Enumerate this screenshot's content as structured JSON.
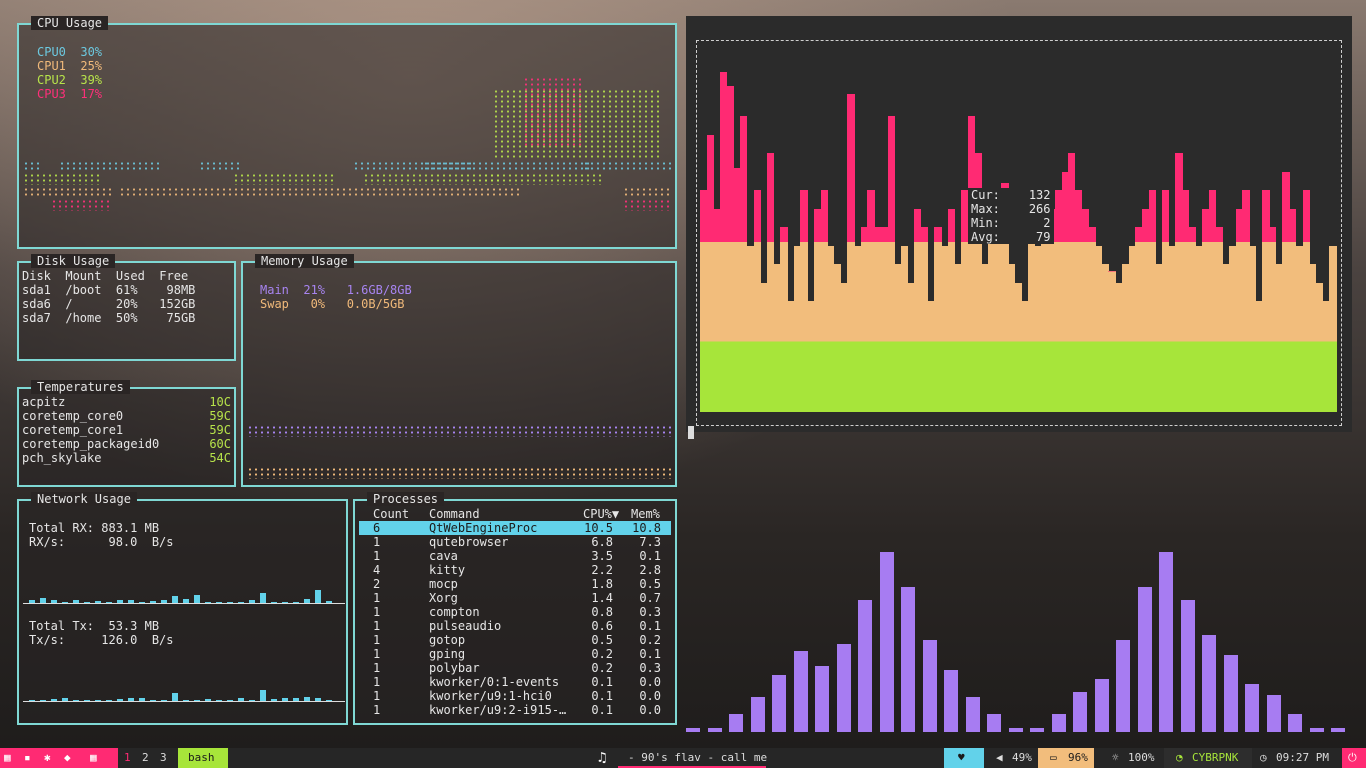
{
  "cpu": {
    "title": "CPU Usage",
    "cores": [
      {
        "name": "CPU0",
        "value": "30%"
      },
      {
        "name": "CPU1",
        "value": "25%"
      },
      {
        "name": "CPU2",
        "value": "39%"
      },
      {
        "name": "CPU3",
        "value": "17%"
      }
    ]
  },
  "disk": {
    "title": "Disk Usage",
    "header": "Disk  Mount  Used  Free",
    "rows": [
      "sda1  /boot  61%    98MB",
      "sda6  /      20%   152GB",
      "sda7  /home  50%    75GB"
    ]
  },
  "memory": {
    "title": "Memory Usage",
    "main": "Main  21%   1.6GB/8GB",
    "swap": "Swap   0%   0.0B/5GB"
  },
  "temps": {
    "title": "Temperatures",
    "rows": [
      {
        "name": "acpitz",
        "value": "10C"
      },
      {
        "name": "coretemp_core0",
        "value": "59C"
      },
      {
        "name": "coretemp_core1",
        "value": "59C"
      },
      {
        "name": "coretemp_packageid0",
        "value": "60C"
      },
      {
        "name": "pch_skylake",
        "value": "54C"
      }
    ]
  },
  "network": {
    "title": "Network Usage",
    "rx_total": "Total RX: 883.1 MB",
    "rx_rate": "RX/s:      98.0  B/s",
    "tx_total": "Total Tx:  53.3 MB",
    "tx_rate": "Tx/s:     126.0  B/s",
    "rx_spark": [
      0.2,
      0.35,
      0.25,
      0.1,
      0.2,
      0,
      0.15,
      0.1,
      0.25,
      0.2,
      0.05,
      0.15,
      0.25,
      0.5,
      0.3,
      0.6,
      0.1,
      0.05,
      0.1,
      0.1,
      0.2,
      0.75,
      0.1,
      0.05,
      0.1,
      0.3,
      0.9,
      0.15
    ],
    "tx_spark": [
      0.05,
      0.1,
      0.15,
      0.25,
      0.1,
      0.05,
      0.1,
      0.05,
      0.15,
      0.2,
      0.2,
      0.05,
      0.1,
      0.6,
      0.1,
      0.05,
      0.15,
      0.1,
      0.1,
      0.2,
      0.05,
      0.8,
      0.15,
      0.2,
      0.25,
      0.3,
      0.2,
      0.05
    ]
  },
  "processes": {
    "title": "Processes",
    "headers": {
      "count": "Count",
      "command": "Command",
      "cpu": "CPU%▼",
      "mem": "Mem%"
    },
    "rows": [
      {
        "count": "6",
        "command": "QtWebEngineProc",
        "cpu": "10.5",
        "mem": "10.8"
      },
      {
        "count": "1",
        "command": "qutebrowser",
        "cpu": "6.8",
        "mem": "7.3"
      },
      {
        "count": "1",
        "command": "cava",
        "cpu": "3.5",
        "mem": "0.1"
      },
      {
        "count": "4",
        "command": "kitty",
        "cpu": "2.2",
        "mem": "2.8"
      },
      {
        "count": "2",
        "command": "mocp",
        "cpu": "1.8",
        "mem": "0.5"
      },
      {
        "count": "1",
        "command": "Xorg",
        "cpu": "1.4",
        "mem": "0.7"
      },
      {
        "count": "1",
        "command": "compton",
        "cpu": "0.8",
        "mem": "0.3"
      },
      {
        "count": "1",
        "command": "pulseaudio",
        "cpu": "0.6",
        "mem": "0.1"
      },
      {
        "count": "1",
        "command": "gotop",
        "cpu": "0.5",
        "mem": "0.2"
      },
      {
        "count": "1",
        "command": "gping",
        "cpu": "0.2",
        "mem": "0.1"
      },
      {
        "count": "1",
        "command": "polybar",
        "cpu": "0.2",
        "mem": "0.3"
      },
      {
        "count": "1",
        "command": "kworker/0:1-events",
        "cpu": "0.1",
        "mem": "0.0"
      },
      {
        "count": "1",
        "command": "kworker/u9:1-hci0",
        "cpu": "0.1",
        "mem": "0.0"
      },
      {
        "count": "1",
        "command": "kworker/u9:2-i915-…",
        "cpu": "0.1",
        "mem": "0.0"
      }
    ]
  },
  "histogram": {
    "stats": {
      "cur_label": "Cur:",
      "cur": "132",
      "max_label": "Max:",
      "max": "266",
      "min_label": "Min:",
      "min": "2",
      "avg_label": "Avg:",
      "avg": "79"
    },
    "levels": [
      0.6,
      0.75,
      0.55,
      0.92,
      0.88,
      0.66,
      0.8,
      0.45,
      0.6,
      0.35,
      0.7,
      0.4,
      0.5,
      0.3,
      0.45,
      0.6,
      0.3,
      0.55,
      0.6,
      0.45,
      0.4,
      0.35,
      0.86,
      0.45,
      0.5,
      0.6,
      0.5,
      0.5,
      0.8,
      0.4,
      0.45,
      0.35,
      0.55,
      0.5,
      0.3,
      0.5,
      0.45,
      0.55,
      0.4,
      0.6,
      0.8,
      0.7,
      0.4,
      0.6,
      0.5,
      0.62,
      0.4,
      0.35,
      0.3,
      0.5,
      0.45,
      0.5,
      0.55,
      0.6,
      0.65,
      0.7,
      0.6,
      0.55,
      0.5,
      0.45,
      0.4,
      0.38,
      0.35,
      0.4,
      0.45,
      0.5,
      0.55,
      0.6,
      0.4,
      0.6,
      0.45,
      0.7,
      0.6,
      0.5,
      0.45,
      0.55,
      0.6,
      0.5,
      0.4,
      0.45,
      0.55,
      0.6,
      0.45,
      0.3,
      0.6,
      0.5,
      0.4,
      0.65,
      0.55,
      0.45,
      0.6,
      0.4,
      0.35,
      0.3,
      0.45
    ],
    "colors": {
      "bottom": "#a7e53a",
      "middle": "#f2bd7c",
      "top": "#ff2a73"
    }
  },
  "cava": {
    "levels": [
      0.02,
      0.02,
      0.08,
      0.16,
      0.26,
      0.37,
      0.3,
      0.4,
      0.6,
      0.82,
      0.66,
      0.42,
      0.28,
      0.16,
      0.08,
      0.02,
      0.02,
      0.08,
      0.18,
      0.24,
      0.42,
      0.66,
      0.82,
      0.6,
      0.44,
      0.35,
      0.22,
      0.17,
      0.08,
      0.02,
      0.02
    ],
    "color": "#a77cf2"
  },
  "statusbar": {
    "workspaces": [
      "1",
      "2",
      "3"
    ],
    "active_window": "bash",
    "now_playing": "- 90's flav - call me",
    "volume": "49%",
    "battery": "96%",
    "brightness": "100%",
    "wifi": "CYBRPNK",
    "clock": "09:27 PM"
  }
}
